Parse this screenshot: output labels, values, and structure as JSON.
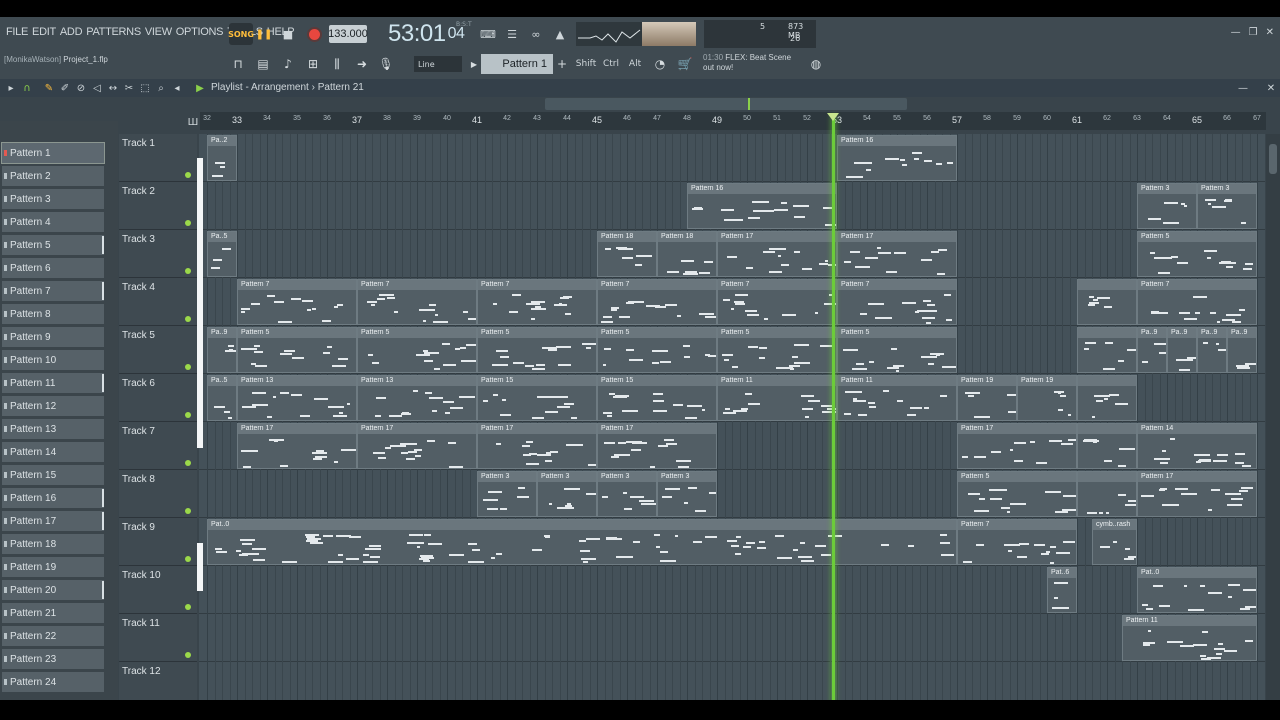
{
  "menu": [
    "FILE",
    "EDIT",
    "ADD",
    "PATTERNS",
    "VIEW",
    "OPTIONS",
    "TOOLS",
    "HELP"
  ],
  "transport": {
    "mode": "SONG",
    "tempo": "133.000",
    "time": "53:01",
    "time_small": "04",
    "time_unit": "B:S:T"
  },
  "cpu": {
    "cpu": "5",
    "memory": "873 MB",
    "voices": "26"
  },
  "project": {
    "user": "[MonikaWatson]",
    "file": "Project_1.flp"
  },
  "toolbar": {
    "snap": "Line",
    "pattern_selector": "Pattern 1",
    "keys": [
      "Shift",
      "Ctrl",
      "Alt"
    ]
  },
  "hint": {
    "time": "01:30",
    "line1": "FLEX: Beat Scene",
    "line2": "out now!"
  },
  "playlist": {
    "title": "Playlist - Arrangement",
    "pattern": "Pattern 21"
  },
  "ruler": {
    "bars": [
      "32",
      "33",
      "34",
      "35",
      "36",
      "37",
      "38",
      "39",
      "40",
      "41",
      "42",
      "43",
      "44",
      "45",
      "46",
      "47",
      "48",
      "49",
      "50",
      "51",
      "52",
      "53",
      "54",
      "55",
      "56",
      "57",
      "58",
      "59",
      "60",
      "61",
      "62",
      "63",
      "64",
      "65",
      "66",
      "67"
    ]
  },
  "patterns": [
    "Pattern 1",
    "Pattern 2",
    "Pattern 3",
    "Pattern 4",
    "Pattern 5",
    "Pattern 6",
    "Pattern 7",
    "Pattern 8",
    "Pattern 9",
    "Pattern 10",
    "Pattern 11",
    "Pattern 12",
    "Pattern 13",
    "Pattern 14",
    "Pattern 15",
    "Pattern 16",
    "Pattern 17",
    "Pattern 18",
    "Pattern 19",
    "Pattern 20",
    "Pattern 21",
    "Pattern 22",
    "Pattern 23",
    "Pattern 24"
  ],
  "tracks": [
    "Track 1",
    "Track 2",
    "Track 3",
    "Track 4",
    "Track 5",
    "Track 6",
    "Track 7",
    "Track 8",
    "Track 9",
    "Track 10",
    "Track 11",
    "Track 12"
  ],
  "clips": [
    {
      "t": 0,
      "s": 32.0,
      "l": 1,
      "n": "Pa..2"
    },
    {
      "t": 0,
      "s": 53.0,
      "l": 4,
      "n": "Pattern 16"
    },
    {
      "t": 1,
      "s": 48.0,
      "l": 5,
      "n": "Pattern 16"
    },
    {
      "t": 1,
      "s": 63.0,
      "l": 2,
      "n": "Pattern 3"
    },
    {
      "t": 1,
      "s": 65.0,
      "l": 2,
      "n": "Pattern 3"
    },
    {
      "t": 2,
      "s": 32.0,
      "l": 1,
      "n": "Pa..5"
    },
    {
      "t": 2,
      "s": 45.0,
      "l": 2,
      "n": "Pattern 18"
    },
    {
      "t": 2,
      "s": 47.0,
      "l": 2,
      "n": "Pattern 18"
    },
    {
      "t": 2,
      "s": 49.0,
      "l": 4,
      "n": "Pattern 17"
    },
    {
      "t": 2,
      "s": 53.0,
      "l": 4,
      "n": "Pattern 17"
    },
    {
      "t": 2,
      "s": 63.0,
      "l": 4,
      "n": "Pattern 5"
    },
    {
      "t": 3,
      "s": 33.0,
      "l": 4,
      "n": "Pattern 7"
    },
    {
      "t": 3,
      "s": 37.0,
      "l": 4,
      "n": "Pattern 7"
    },
    {
      "t": 3,
      "s": 41.0,
      "l": 4,
      "n": "Pattern 7"
    },
    {
      "t": 3,
      "s": 45.0,
      "l": 4,
      "n": "Pattern 7"
    },
    {
      "t": 3,
      "s": 49.0,
      "l": 4,
      "n": "Pattern 7"
    },
    {
      "t": 3,
      "s": 53.0,
      "l": 4,
      "n": "Pattern 7"
    },
    {
      "t": 3,
      "s": 61.0,
      "l": 2,
      "n": ""
    },
    {
      "t": 3,
      "s": 63.0,
      "l": 4,
      "n": "Pattern 7"
    },
    {
      "t": 4,
      "s": 32.0,
      "l": 1,
      "n": "Pa..9"
    },
    {
      "t": 4,
      "s": 33.0,
      "l": 4,
      "n": "Pattern 5"
    },
    {
      "t": 4,
      "s": 37.0,
      "l": 4,
      "n": "Pattern 5"
    },
    {
      "t": 4,
      "s": 41.0,
      "l": 4,
      "n": "Pattern 5"
    },
    {
      "t": 4,
      "s": 45.0,
      "l": 4,
      "n": "Pattern 5"
    },
    {
      "t": 4,
      "s": 49.0,
      "l": 4,
      "n": "Pattern 5"
    },
    {
      "t": 4,
      "s": 53.0,
      "l": 4,
      "n": "Pattern 5"
    },
    {
      "t": 4,
      "s": 61.0,
      "l": 2,
      "n": ""
    },
    {
      "t": 4,
      "s": 63.0,
      "l": 1,
      "n": "Pa..9"
    },
    {
      "t": 4,
      "s": 64.0,
      "l": 1,
      "n": "Pa..9"
    },
    {
      "t": 4,
      "s": 65.0,
      "l": 1,
      "n": "Pa..9"
    },
    {
      "t": 4,
      "s": 66.0,
      "l": 1,
      "n": "Pa..9"
    },
    {
      "t": 5,
      "s": 32.0,
      "l": 1,
      "n": "Pa..5"
    },
    {
      "t": 5,
      "s": 33.0,
      "l": 4,
      "n": "Pattern 13"
    },
    {
      "t": 5,
      "s": 37.0,
      "l": 4,
      "n": "Pattern 13"
    },
    {
      "t": 5,
      "s": 41.0,
      "l": 4,
      "n": "Pattern 15"
    },
    {
      "t": 5,
      "s": 45.0,
      "l": 4,
      "n": "Pattern 15"
    },
    {
      "t": 5,
      "s": 49.0,
      "l": 4,
      "n": "Pattern 11"
    },
    {
      "t": 5,
      "s": 53.0,
      "l": 4,
      "n": "Pattern 11"
    },
    {
      "t": 5,
      "s": 57.0,
      "l": 2,
      "n": "Pattern 19"
    },
    {
      "t": 5,
      "s": 59.0,
      "l": 2,
      "n": "Pattern 19"
    },
    {
      "t": 5,
      "s": 61.0,
      "l": 2,
      "n": ""
    },
    {
      "t": 6,
      "s": 33.0,
      "l": 4,
      "n": "Pattern 17"
    },
    {
      "t": 6,
      "s": 37.0,
      "l": 4,
      "n": "Pattern 17"
    },
    {
      "t": 6,
      "s": 41.0,
      "l": 4,
      "n": "Pattern 17"
    },
    {
      "t": 6,
      "s": 45.0,
      "l": 4,
      "n": "Pattern 17"
    },
    {
      "t": 6,
      "s": 57.0,
      "l": 4,
      "n": "Pattern 17"
    },
    {
      "t": 6,
      "s": 61.0,
      "l": 2,
      "n": ""
    },
    {
      "t": 6,
      "s": 63.0,
      "l": 4,
      "n": "Pattern 14"
    },
    {
      "t": 7,
      "s": 41.0,
      "l": 2,
      "n": "Pattern 3"
    },
    {
      "t": 7,
      "s": 43.0,
      "l": 2,
      "n": "Pattern 3"
    },
    {
      "t": 7,
      "s": 45.0,
      "l": 2,
      "n": "Pattern 3"
    },
    {
      "t": 7,
      "s": 47.0,
      "l": 2,
      "n": "Pattern 3"
    },
    {
      "t": 7,
      "s": 57.0,
      "l": 4,
      "n": "Pattern 5"
    },
    {
      "t": 7,
      "s": 61.0,
      "l": 2,
      "n": ""
    },
    {
      "t": 7,
      "s": 63.0,
      "l": 4,
      "n": "Pattern 17"
    },
    {
      "t": 8,
      "s": 32.0,
      "l": 25,
      "n": "Pat..0"
    },
    {
      "t": 8,
      "s": 57.0,
      "l": 4,
      "n": "Pattern 7"
    },
    {
      "t": 8,
      "s": 61.5,
      "l": 1.5,
      "n": "cymb..rash"
    },
    {
      "t": 9,
      "s": 60.0,
      "l": 1,
      "n": "Pat..6"
    },
    {
      "t": 9,
      "s": 63.0,
      "l": 4,
      "n": "Pat..0"
    },
    {
      "t": 10,
      "s": 62.5,
      "l": 4.5,
      "n": "Pattern 11"
    }
  ]
}
